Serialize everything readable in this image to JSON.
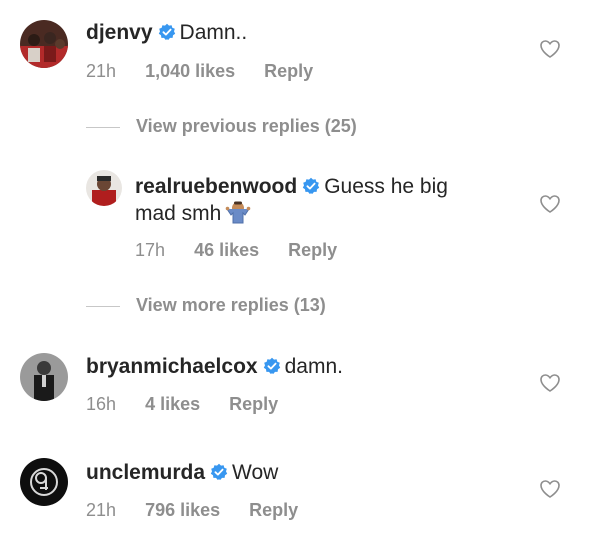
{
  "comments": [
    {
      "username": "djenvy",
      "text": "Damn..",
      "time": "21h",
      "likes": "1,040 likes",
      "reply": "Reply",
      "avatar": "djenvy-avatar"
    },
    {
      "username": "realruebenwood",
      "text": "Guess he big",
      "text2": "mad smh",
      "time": "17h",
      "likes": "46 likes",
      "reply": "Reply",
      "avatar": "realruebenwood-avatar"
    },
    {
      "username": "bryanmichaelcox",
      "text": "damn.",
      "time": "16h",
      "likes": "4 likes",
      "reply": "Reply",
      "avatar": "bryanmichaelcox-avatar"
    },
    {
      "username": "unclemurda",
      "text": "Wow",
      "time": "21h",
      "likes": "796 likes",
      "reply": "Reply",
      "avatar": "unclemurda-avatar"
    }
  ],
  "toggles": {
    "previous": "View previous replies (25)",
    "more": "View more replies (13)"
  },
  "colors": {
    "verified": "#3897f0",
    "meta": "#8e8e8e",
    "text": "#262626"
  },
  "icons": {
    "like": "heart-outline-icon",
    "verified": "verified-badge-icon",
    "emoji": "man-shrugging-emoji"
  }
}
